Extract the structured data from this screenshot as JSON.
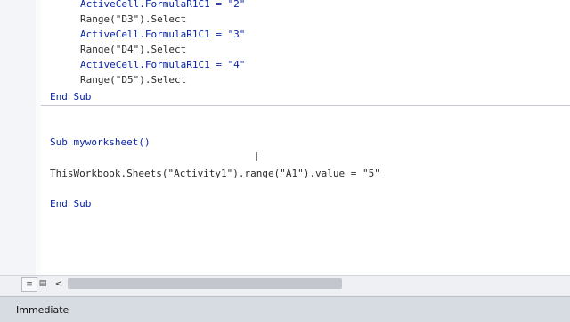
{
  "code_editor": {
    "lines_top": [
      "ActiveCell.FormulaR1C1 = \"2\"",
      "Range(\"D3\").Select",
      "ActiveCell.FormulaR1C1 = \"3\"",
      "Range(\"D4\").Select",
      "ActiveCell.FormulaR1C1 = \"4\"",
      "Range(\"D5\").Select"
    ],
    "end_sub_1": "End Sub",
    "sub_header": "Sub myworksheet()",
    "statement": "ThisWorkbook.Sheets(\"Activity1\").range(\"A1\").value = \"5\"",
    "end_sub_2": "End Sub"
  },
  "scrollbar": {
    "left_arrow": "<",
    "thumb_fraction": 0.55
  },
  "immediate_window": {
    "title": "Immediate"
  },
  "icons": {
    "split": "split-view-icon",
    "view": "procedure-view-icon"
  }
}
